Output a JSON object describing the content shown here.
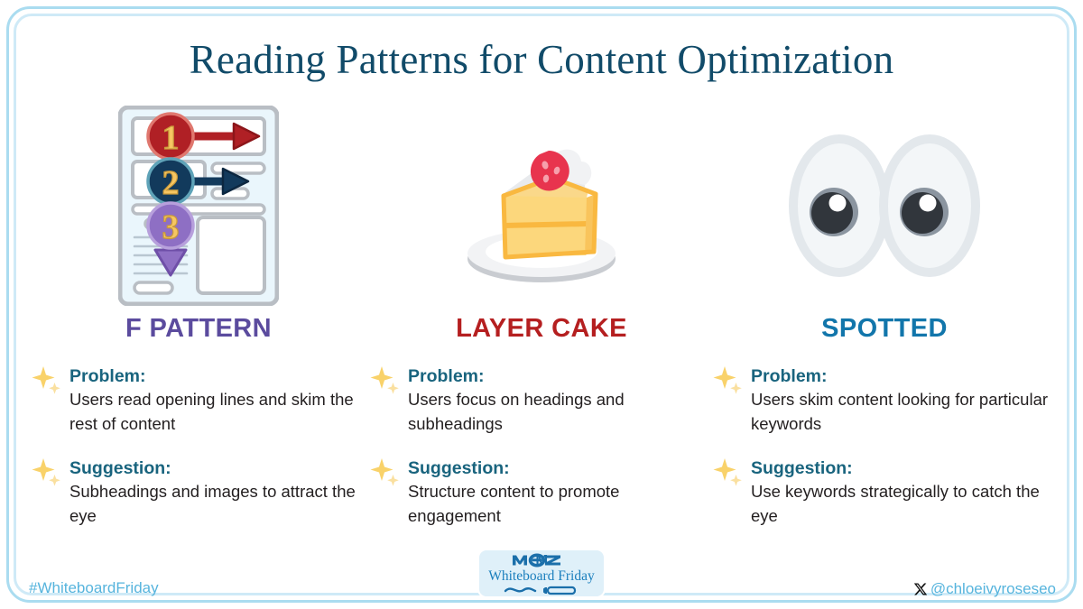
{
  "title": "Reading Patterns for Content Optimization",
  "theme": {
    "title_color": "#114b69",
    "frame_outer_color": "#aadcf0",
    "frame_inner_color": "#cfeaf7",
    "label_color": "#19647e",
    "body_color": "#231f20",
    "sparkle_color": "#f9d26a",
    "footer_color": "#56b4dd"
  },
  "columns": [
    {
      "heading": "F PATTERN",
      "heading_color": "#5b4b9e",
      "icon_name": "f-pattern-document-illustration",
      "blocks": [
        {
          "label": "Problem:",
          "text": "Users read opening lines and skim the rest of content"
        },
        {
          "label": "Suggestion:",
          "text": "Subheadings and images to attract the eye"
        }
      ]
    },
    {
      "heading": "LAYER CAKE",
      "heading_color": "#b51f20",
      "icon_name": "layer-cake-slice-illustration",
      "blocks": [
        {
          "label": "Problem:",
          "text": "Users focus on headings and subheadings"
        },
        {
          "label": "Suggestion:",
          "text": "Structure content to promote engagement"
        }
      ]
    },
    {
      "heading": "SPOTTED",
      "heading_color": "#1276ab",
      "icon_name": "eyes-illustration",
      "blocks": [
        {
          "label": "Problem:",
          "text": "Users skim content looking for particular keywords"
        },
        {
          "label": "Suggestion:",
          "text": "Use keywords strategically to catch the eye"
        }
      ]
    }
  ],
  "illustration_numbers": [
    "1",
    "2",
    "3"
  ],
  "footer": {
    "hashtag": "#WhiteboardFriday",
    "handle": "@chloeivyroseseo",
    "handle_icon": "x-twitter-icon"
  },
  "badge": {
    "brand": "MOZ",
    "subtitle": "Whiteboard Friday"
  }
}
